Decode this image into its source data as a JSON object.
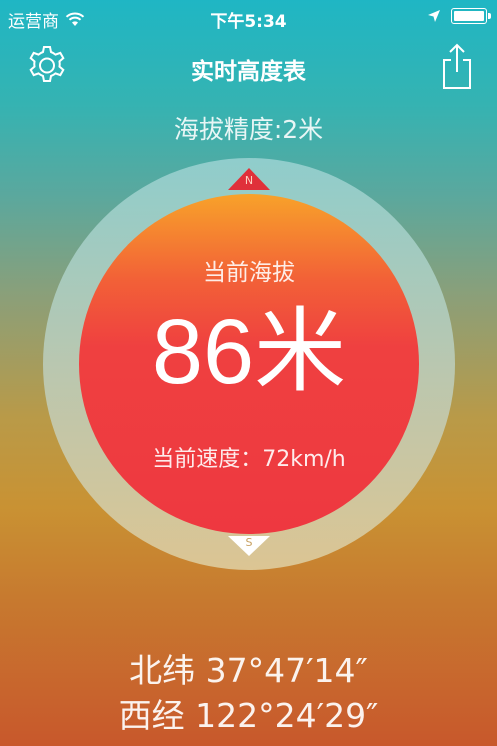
{
  "status_bar": {
    "carrier": "运营商",
    "time": "下午5:34"
  },
  "nav": {
    "title": "实时高度表",
    "settings_icon": "gear-icon",
    "share_icon": "share-icon"
  },
  "accuracy": "海拔精度:2米",
  "gauge": {
    "north": "N",
    "south": "S",
    "altitude_label": "当前海拔",
    "altitude_value": "86米",
    "speed": "当前速度：72km/h"
  },
  "coords": {
    "latitude": "北纬 37°47′14″",
    "longitude": "西经 122°24′29″"
  },
  "colors": {
    "accent_red": "#ee3840",
    "accent_orange": "#f8a22a",
    "marker_red": "#e0303a"
  }
}
